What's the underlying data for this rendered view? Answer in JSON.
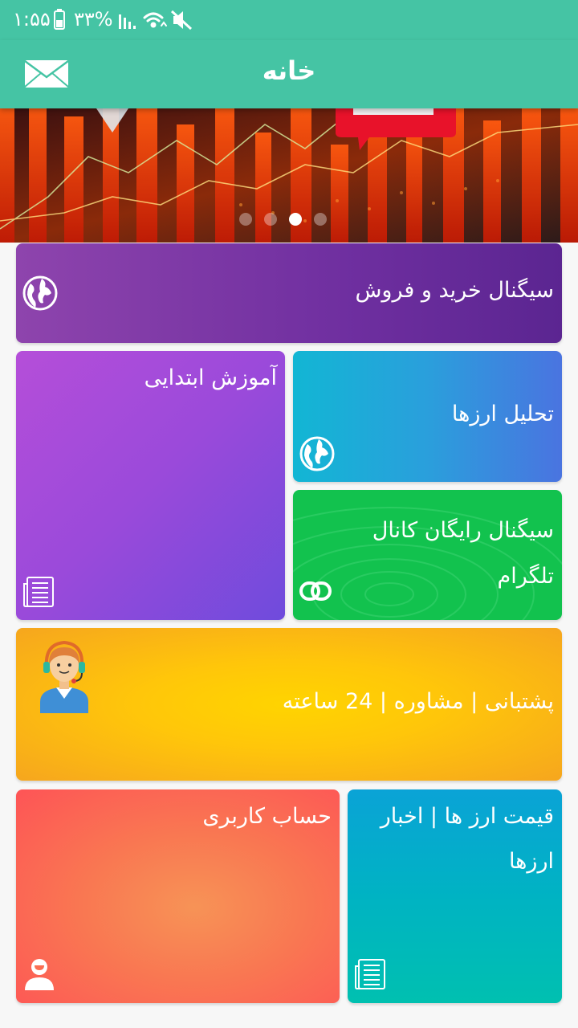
{
  "status_bar": {
    "time": "۱:۵۵",
    "battery": "۳۳%",
    "icons": [
      "battery-icon",
      "signal-icon",
      "wifi-icon",
      "mute-icon"
    ]
  },
  "app_bar": {
    "title": "خانه",
    "mail_icon": "mail-icon"
  },
  "banner": {
    "slides": 4,
    "active_slide": 3
  },
  "tiles": {
    "signal": {
      "label": "سیگنال خرید و فروش",
      "icon": "globe-icon",
      "color": "#7d34a6"
    },
    "beginner": {
      "label": "آموزش ابتدایی",
      "icon": "newspaper-icon",
      "color": "#9a4ada"
    },
    "analysis": {
      "label": "تحلیل ارزها",
      "icon": "globe-icon",
      "color": "#2a9fdc"
    },
    "telegram": {
      "line1": "سیگنال رایگان کانال",
      "line2": "تلگرام",
      "icon": "link-icon",
      "color": "#12c24e"
    },
    "support": {
      "label": "پشتبانی | مشاوره | 24 ساعته",
      "icon": "support-agent-icon",
      "color": "#ffc60a"
    },
    "account": {
      "label": "حساب کاربری",
      "icon": "user-icon",
      "color": "#fa7052"
    },
    "prices": {
      "line1": "قیمت ارز ها | اخبار",
      "line2": "ارزها",
      "icon": "newspaper-icon",
      "color": "#00b3c3"
    }
  }
}
